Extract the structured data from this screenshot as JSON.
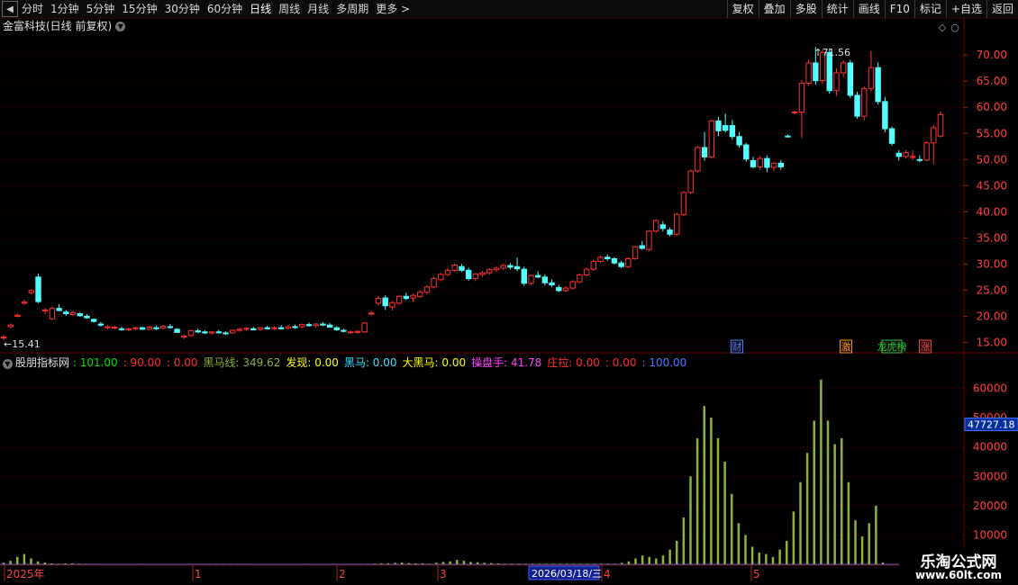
{
  "toolbar": {
    "back_label": "◀",
    "tabs": [
      "分时",
      "1分钟",
      "5分钟",
      "15分钟",
      "30分钟",
      "60分钟",
      "日线",
      "周线",
      "月线",
      "多周期",
      "更多 >"
    ],
    "active_tab": "日线",
    "tools": [
      "复权",
      "叠加",
      "多股",
      "统计",
      "画线",
      "F10",
      "标记",
      "+自选",
      "返回"
    ]
  },
  "stock": {
    "title": "金富科技(日线 前复权)"
  },
  "price_axis": {
    "ticks": [
      "70.00",
      "65.00",
      "60.00",
      "55.00",
      "50.00",
      "45.00",
      "40.00",
      "35.00",
      "30.00",
      "25.00",
      "20.00",
      "15.00"
    ]
  },
  "markers": {
    "high": "71.56",
    "low": "15.41"
  },
  "event_tags": [
    {
      "label": "财",
      "color": "#4a7cff"
    },
    {
      "label": "激",
      "color": "#ff8c1a"
    },
    {
      "label": "龙虎榜",
      "color": "#30c030"
    },
    {
      "label": "涨",
      "color": "#ff4040"
    }
  ],
  "indicator": {
    "name": "股朋指标网",
    "items": [
      {
        "text": ": 101.00",
        "color": "#00e000"
      },
      {
        "text": ": 90.00",
        "color": "#ff3030"
      },
      {
        "text": ": 0.00",
        "color": "#ff3030"
      },
      {
        "text": "黑马线: 349.62",
        "color": "#8db33a"
      },
      {
        "text": "发现: 0.00",
        "color": "#ffff00"
      },
      {
        "text": "黑马: 0.00",
        "color": "#40e0ff"
      },
      {
        "text": "大黑马: 0.00",
        "color": "#ffff00"
      },
      {
        "text": "操盘手: 41.78",
        "color": "#ff40ff"
      },
      {
        "text": "庄拉: 0.00",
        "color": "#ff3030"
      },
      {
        "text": ": 0.00",
        "color": "#ff3030"
      },
      {
        "text": ": 100.00",
        "color": "#4a7cff"
      }
    ],
    "axis_ticks": [
      "60000",
      "50000",
      "40000",
      "30000",
      "20000",
      "10000"
    ],
    "current_value": "47727.18"
  },
  "date_axis": {
    "labels": [
      "2025年",
      "1",
      "2",
      "3",
      "4",
      "5"
    ],
    "cursor_date": "2026/03/18/三"
  },
  "watermark": {
    "line1": "乐淘公式网",
    "line2": "www.60lt.com"
  },
  "colors": {
    "up": "#ff3030",
    "down": "#54ffff",
    "bar": "#8db33a",
    "grid": "#5a0000"
  },
  "chart_data": [
    {
      "type": "candlestick",
      "title": "金富科技(日线 前复权)",
      "ylim": [
        13,
        74
      ],
      "ohlc": [
        [
          16,
          16.4,
          15.41,
          16
        ],
        [
          18,
          18.6,
          17.7,
          18.3
        ],
        [
          20,
          20.5,
          19.8,
          20.2
        ],
        [
          22.5,
          23.2,
          22.2,
          22.7
        ],
        [
          24.5,
          25.2,
          24.1,
          24.9
        ],
        [
          27.5,
          28.2,
          22.5,
          22.8
        ],
        [
          21,
          21.6,
          20.4,
          21.2
        ],
        [
          19.5,
          21.8,
          19.3,
          21.5
        ],
        [
          21.5,
          22.3,
          20.9,
          21.1
        ],
        [
          20.8,
          21.2,
          20.1,
          20.5
        ],
        [
          20.3,
          21,
          20.1,
          20.7
        ],
        [
          20.5,
          20.8,
          19.9,
          20.1
        ],
        [
          20,
          20.4,
          19.5,
          19.7
        ],
        [
          19.4,
          19.6,
          18.8,
          19
        ],
        [
          18.5,
          18.9,
          18,
          18.3
        ],
        [
          17.8,
          18.3,
          17.5,
          18
        ],
        [
          17.8,
          18.2,
          17.5,
          17.9
        ],
        [
          17.6,
          18,
          17.2,
          17.5
        ],
        [
          17.4,
          17.8,
          17.1,
          17.6
        ],
        [
          17.6,
          18,
          17.3,
          17.8
        ],
        [
          17.8,
          18,
          17.4,
          17.5
        ],
        [
          17.5,
          18.1,
          17.3,
          17.9
        ],
        [
          17.8,
          18.2,
          17.4,
          17.6
        ],
        [
          17.7,
          18.3,
          17.5,
          18.1
        ],
        [
          18,
          18.5,
          17.6,
          17.9
        ],
        [
          17.5,
          17.7,
          16.8,
          16.9
        ],
        [
          16,
          16.4,
          15.6,
          16.2
        ],
        [
          16.3,
          17.4,
          16.1,
          17.2
        ],
        [
          17.2,
          17.6,
          16.8,
          17
        ],
        [
          17,
          17.3,
          16.6,
          16.8
        ],
        [
          16.8,
          17.2,
          16.5,
          17
        ],
        [
          17,
          17.4,
          16.7,
          16.9
        ],
        [
          16.8,
          17.1,
          16.4,
          16.7
        ],
        [
          16.8,
          17.5,
          16.6,
          17.3
        ],
        [
          17.3,
          17.8,
          17,
          17.5
        ],
        [
          17.5,
          17.9,
          17.2,
          17.7
        ],
        [
          17.6,
          18,
          17.3,
          17.4
        ],
        [
          17.5,
          17.9,
          17.2,
          17.8
        ],
        [
          17.8,
          18.2,
          17.5,
          17.6
        ],
        [
          17.7,
          18.1,
          17.4,
          17.8
        ],
        [
          17.8,
          18.3,
          17.5,
          17.6
        ],
        [
          17.7,
          18.3,
          17.5,
          18
        ],
        [
          18,
          18.4,
          17.6,
          17.9
        ],
        [
          18,
          18.6,
          17.7,
          18.4
        ],
        [
          18.4,
          18.8,
          18,
          18.2
        ],
        [
          18.2,
          18.7,
          17.8,
          18.5
        ],
        [
          18.5,
          18.9,
          18.1,
          18.3
        ],
        [
          18.3,
          18.7,
          17.8,
          17.9
        ],
        [
          17.8,
          18.1,
          17.2,
          17.4
        ],
        [
          17.3,
          17.6,
          16.9,
          17.1
        ],
        [
          17,
          17.3,
          16.7,
          17
        ],
        [
          16.9,
          17.3,
          16.6,
          17.1
        ],
        [
          17,
          18.9,
          16.8,
          18.7
        ],
        [
          20.5,
          21,
          20.2,
          20.6
        ],
        [
          22.5,
          23.8,
          22.1,
          23.4
        ],
        [
          23.5,
          24,
          21.2,
          22
        ],
        [
          21.8,
          22.9,
          21.1,
          22.6
        ],
        [
          22.5,
          24.1,
          22.2,
          23.8
        ],
        [
          23.8,
          24.5,
          23.1,
          23.4
        ],
        [
          23.5,
          24.3,
          22.8,
          24
        ],
        [
          23.8,
          25,
          23.5,
          24.6
        ],
        [
          24.6,
          25.9,
          24.2,
          25.6
        ],
        [
          25.6,
          27.5,
          25.3,
          27.2
        ],
        [
          27,
          28.3,
          26.7,
          28
        ],
        [
          28,
          29.2,
          27.7,
          28.8
        ],
        [
          28.8,
          30.1,
          28.5,
          29.8
        ],
        [
          29.5,
          30,
          28.5,
          28.8
        ],
        [
          28.8,
          29.3,
          26.8,
          27.2
        ],
        [
          27.2,
          28.3,
          26.7,
          28.1
        ],
        [
          28,
          28.7,
          27.5,
          28.3
        ],
        [
          28.3,
          29.2,
          28,
          28.9
        ],
        [
          28.9,
          29.6,
          28.5,
          29.2
        ],
        [
          29.2,
          30.1,
          28.8,
          29.7
        ],
        [
          29.7,
          30.2,
          29,
          29.4
        ],
        [
          29.5,
          31.2,
          28.6,
          29.1
        ],
        [
          29,
          29.5,
          25.8,
          26.3
        ],
        [
          26.3,
          28,
          26,
          27.8
        ],
        [
          27.8,
          28.6,
          27.3,
          27.5
        ],
        [
          27.5,
          28,
          25.9,
          26.4
        ],
        [
          26.4,
          27,
          25.6,
          26
        ],
        [
          25.5,
          26,
          24.6,
          24.9
        ],
        [
          24.9,
          25.8,
          24.6,
          25.4
        ],
        [
          25.4,
          26.9,
          25.1,
          26.6
        ],
        [
          26.6,
          28.2,
          26.3,
          27.9
        ],
        [
          27.9,
          29.3,
          27.6,
          29
        ],
        [
          29,
          30.8,
          28.7,
          30.5
        ],
        [
          30.5,
          31.6,
          30.2,
          31.3
        ],
        [
          31.3,
          31.8,
          30.6,
          31
        ],
        [
          31,
          31.3,
          29.9,
          30.2
        ],
        [
          30.2,
          30.6,
          29.2,
          29.5
        ],
        [
          29.5,
          31.3,
          29.2,
          31
        ],
        [
          31,
          33.5,
          30.8,
          33.3
        ],
        [
          33.5,
          34.4,
          32.7,
          33
        ],
        [
          32.8,
          36.5,
          32.5,
          36.3
        ],
        [
          36.3,
          38.6,
          36,
          38.3
        ],
        [
          37.5,
          38.2,
          36.2,
          36.8
        ],
        [
          36.5,
          37,
          35.3,
          35.7
        ],
        [
          35.7,
          39.8,
          35.4,
          39.5
        ],
        [
          39.5,
          44,
          39.2,
          43.7
        ],
        [
          43.7,
          48.1,
          43.4,
          47.8
        ],
        [
          47.8,
          52.6,
          47.5,
          52.3
        ],
        [
          52.3,
          55.3,
          49.8,
          50.5
        ],
        [
          50.5,
          57.7,
          50.2,
          57.4
        ],
        [
          57.4,
          58.2,
          54.5,
          55.5
        ],
        [
          56.5,
          58.8,
          55.2,
          55.6
        ],
        [
          56.5,
          57.6,
          53.8,
          54.4
        ],
        [
          54.4,
          55.3,
          52.3,
          52.8
        ],
        [
          52.8,
          53.2,
          49.6,
          50.1
        ],
        [
          49.8,
          50.5,
          48.3,
          48.6
        ],
        [
          48.6,
          50.7,
          48,
          50.2
        ],
        [
          50.2,
          50.8,
          47.6,
          48.5
        ],
        [
          48.5,
          49.6,
          47.8,
          49.3
        ],
        [
          49.3,
          49.9,
          48,
          48.6
        ],
        [
          54.5,
          54.8,
          54.2,
          54.4
        ],
        [
          59,
          59.4,
          58.7,
          59.1
        ],
        [
          59.1,
          65.2,
          54.1,
          64.6
        ],
        [
          64.6,
          69.2,
          64.1,
          68.5
        ],
        [
          68.5,
          71.56,
          64.3,
          65.1
        ],
        [
          65.1,
          71,
          64.5,
          70.5
        ],
        [
          70.5,
          71.3,
          62.6,
          63.2
        ],
        [
          63.2,
          67.5,
          62.2,
          66.6
        ],
        [
          66.6,
          69,
          65.8,
          68.5
        ],
        [
          68.5,
          69.1,
          61.8,
          62.3
        ],
        [
          62.3,
          63,
          57.8,
          58.3
        ],
        [
          58.3,
          64,
          57.5,
          63.6
        ],
        [
          63.6,
          70.8,
          63,
          67.6
        ],
        [
          67.6,
          68.6,
          60.5,
          61.1
        ],
        [
          61.1,
          62,
          55.2,
          55.9
        ],
        [
          55.9,
          56.3,
          52.7,
          53.1
        ],
        [
          51.2,
          51.8,
          49.8,
          50.6
        ],
        [
          50.6,
          51.8,
          50.2,
          51.3
        ],
        [
          50.4,
          51.8,
          49.9,
          50.6
        ],
        [
          50,
          50.8,
          49.5,
          49.9
        ],
        [
          49.9,
          53.5,
          49.7,
          53.2
        ],
        [
          53.2,
          56.7,
          49.2,
          56.1
        ],
        [
          54.5,
          59.2,
          54.2,
          58.6
        ]
      ]
    },
    {
      "type": "bar",
      "title": "股朋指标网",
      "ylim": [
        0,
        66000
      ],
      "values": [
        500,
        1200,
        2500,
        3500,
        2000,
        1000,
        600,
        300,
        200,
        300,
        300,
        200,
        100,
        100,
        100,
        100,
        100,
        100,
        100,
        100,
        100,
        100,
        100,
        100,
        100,
        100,
        100,
        100,
        100,
        100,
        100,
        100,
        100,
        100,
        100,
        100,
        100,
        100,
        100,
        100,
        100,
        100,
        100,
        100,
        100,
        100,
        100,
        100,
        100,
        100,
        100,
        100,
        100,
        100,
        200,
        300,
        300,
        500,
        600,
        400,
        300,
        300,
        200,
        500,
        800,
        1000,
        1500,
        1200,
        800,
        700,
        500,
        400,
        300,
        200,
        200,
        200,
        200,
        200,
        200,
        200,
        200,
        200,
        200,
        200,
        200,
        200,
        200,
        200,
        200,
        200,
        500,
        1000,
        2000,
        3000,
        2500,
        2000,
        3000,
        5000,
        8000,
        16000,
        30000,
        43000,
        54000,
        50000,
        43000,
        35000,
        24000,
        14000,
        10000,
        6000,
        4000,
        3500,
        2500,
        5000,
        8000,
        18000,
        28000,
        38000,
        49000,
        63000,
        49000,
        41000,
        43000,
        28000,
        15000,
        9500,
        14000,
        20000,
        600
      ]
    }
  ]
}
